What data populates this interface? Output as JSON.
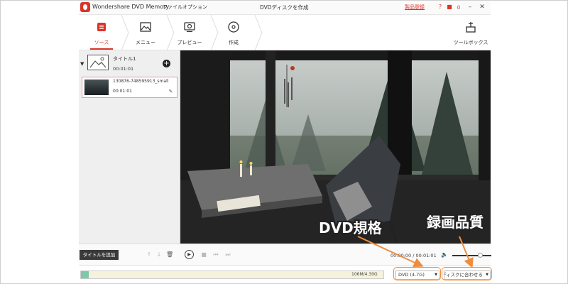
{
  "app": {
    "name": "Wondershare DVD Memory",
    "menus": [
      "ファイル",
      "オプション"
    ],
    "window_title": "DVDディスクを作成",
    "register_label": "製品登録"
  },
  "steps": [
    {
      "label": "ソース",
      "icon": "source-icon",
      "active": true
    },
    {
      "label": "メニュー",
      "icon": "menu-icon",
      "active": false
    },
    {
      "label": "プレビュー",
      "icon": "preview-icon",
      "active": false
    },
    {
      "label": "作成",
      "icon": "disc-icon",
      "active": false
    }
  ],
  "toolbox": {
    "label": "ツールボックス",
    "icon": "toolbox-icon"
  },
  "titles": [
    {
      "name": "タイトル1",
      "duration": "00:01:01",
      "clips": [
        {
          "name": "130876-748595913_small",
          "duration": "00:01:01"
        }
      ]
    }
  ],
  "controls": {
    "add_title": "タイトルを追加",
    "time": "00:00:00 / 00:01:01",
    "volume_level": 0.7
  },
  "status": {
    "capacity_text": "106M/4.30G",
    "capacity_used_fraction": 0.025,
    "dvd_type": "DVD (4.7G)",
    "quality": "ディスクに合わせる"
  },
  "annotations": {
    "dvd_spec": "DVD規格",
    "record_quality": "録画品質",
    "color": "#ef8d3d"
  }
}
